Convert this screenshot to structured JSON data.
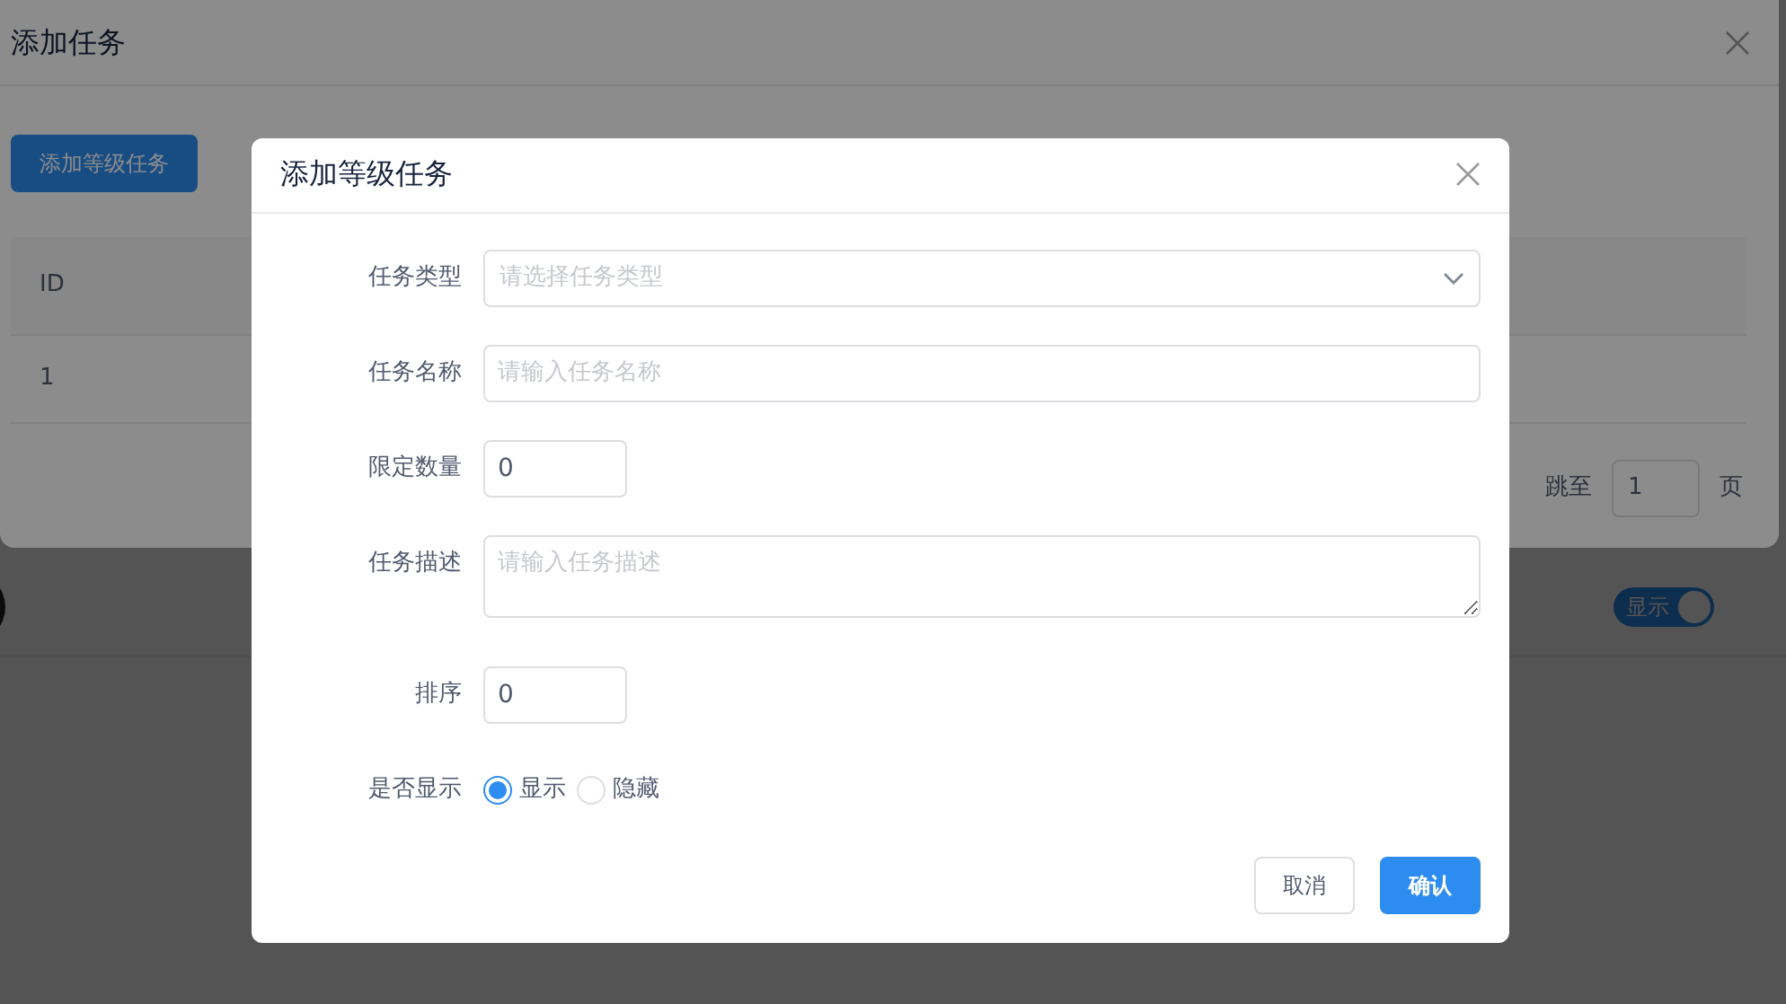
{
  "background_dialog": {
    "title": "添加任务",
    "add_button": "添加等级任务",
    "table": {
      "columns": [
        "ID"
      ],
      "rows": [
        [
          "1"
        ]
      ]
    },
    "pagination": {
      "jump_label": "跳至",
      "page_value": "1",
      "page_suffix": "页"
    }
  },
  "background_row": {
    "switch": {
      "label": "显示",
      "on": true
    }
  },
  "dialog": {
    "title": "添加等级任务",
    "fields": [
      {
        "kind": "select",
        "label": "任务类型",
        "placeholder": "请选择任务类型"
      },
      {
        "kind": "text",
        "label": "任务名称",
        "placeholder": "请输入任务名称"
      },
      {
        "kind": "number",
        "label": "限定数量",
        "value": "0"
      },
      {
        "kind": "textarea",
        "label": "任务描述",
        "placeholder": "请输入任务描述"
      },
      {
        "kind": "number",
        "label": "排序",
        "value": "0"
      },
      {
        "kind": "radio",
        "label": "是否显示",
        "options": [
          {
            "label": "显示",
            "selected": true
          },
          {
            "label": "隐藏",
            "selected": false
          }
        ]
      }
    ],
    "buttons": [
      {
        "label": "取消",
        "kind": "default"
      },
      {
        "label": "确认",
        "kind": "primary"
      }
    ]
  }
}
